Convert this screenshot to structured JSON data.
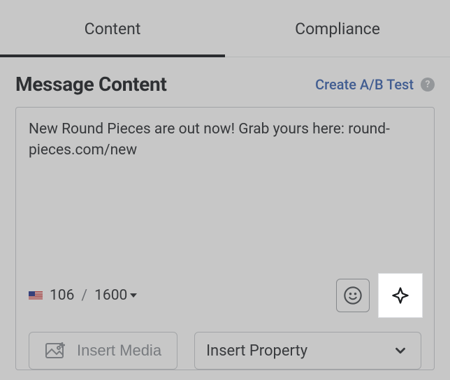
{
  "tabs": {
    "content": "Content",
    "compliance": "Compliance",
    "active": "content"
  },
  "header": {
    "title": "Message Content",
    "ab_link": "Create A/B Test",
    "help_symbol": "?"
  },
  "editor": {
    "message_value": "New Round Pieces are out now! Grab yours here: round-pieces.com/new",
    "char_count": "106",
    "char_separator": "/",
    "char_limit": "1600"
  },
  "toolbar": {
    "insert_media_label": "Insert Media",
    "insert_property_label": "Insert Property"
  },
  "icons": {
    "emoji": "emoji-icon",
    "ai": "ai-sparkle-icon",
    "media": "image-plus-icon",
    "help": "help-circle-icon",
    "flag": "us-flag-icon",
    "chevron": "chevron-down-icon",
    "caret": "caret-down-icon"
  }
}
